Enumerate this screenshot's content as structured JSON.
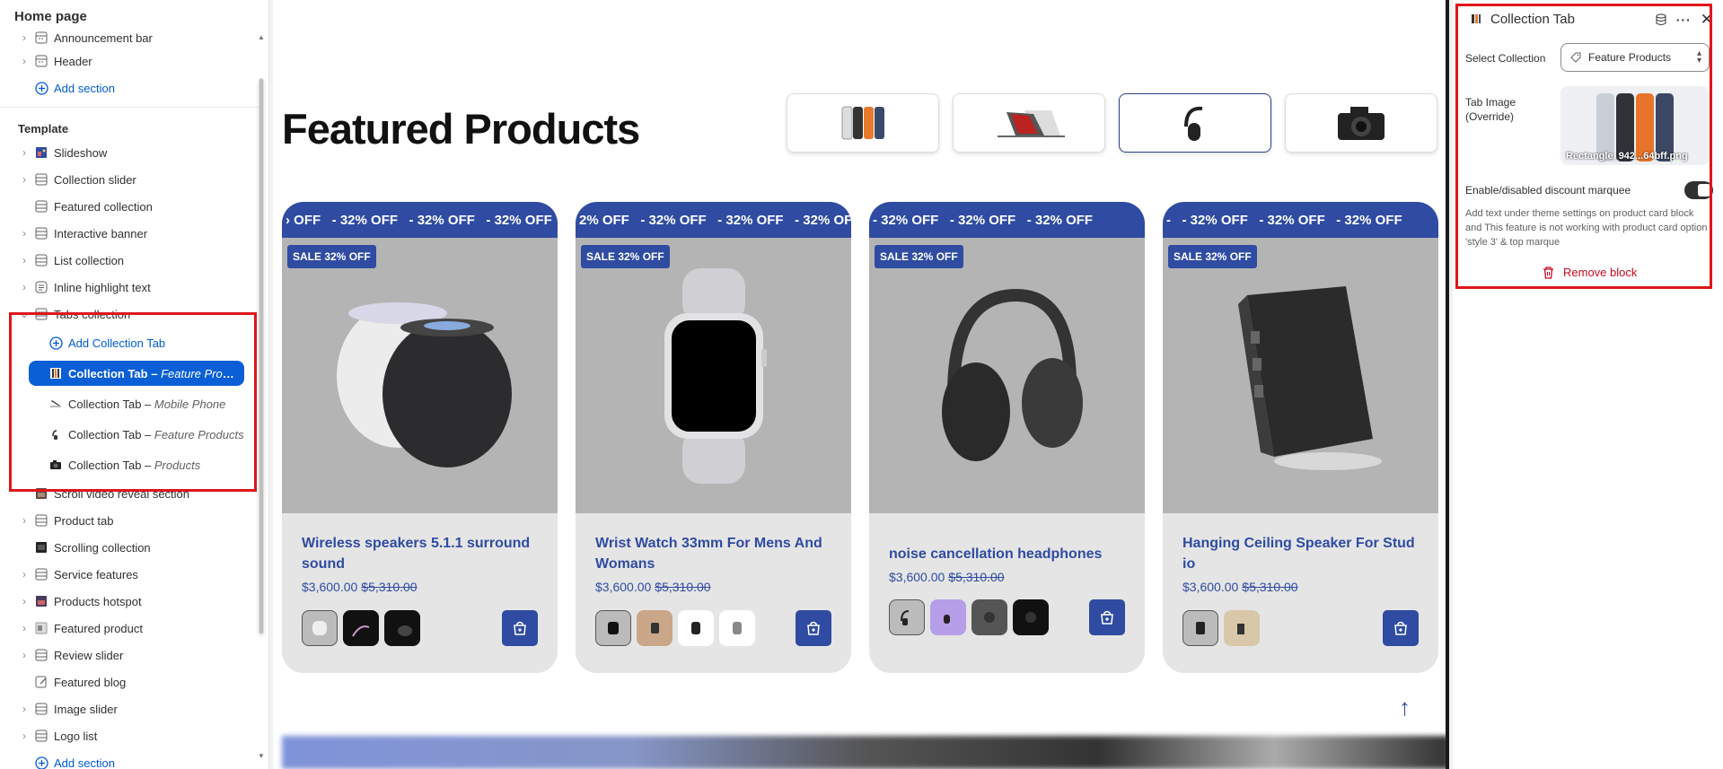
{
  "sidebar": {
    "title": "Home page",
    "header_items": [
      {
        "label": "Announcement bar"
      },
      {
        "label": "Header"
      }
    ],
    "add_section_label": "Add section",
    "template_heading": "Template",
    "template_items_before": [
      {
        "label": "Slideshow"
      },
      {
        "label": "Collection slider"
      },
      {
        "label": "Featured collection"
      },
      {
        "label": "Interactive banner"
      },
      {
        "label": "List collection"
      },
      {
        "label": "Inline highlight text"
      },
      {
        "label": "Tabs collection"
      }
    ],
    "tabs_children": {
      "add_label": "Add Collection Tab",
      "tabs": [
        {
          "label": "Collection Tab",
          "sep": " – ",
          "sub": "Feature Products"
        },
        {
          "label": "Collection Tab",
          "sep": " – ",
          "sub": "Mobile Phone"
        },
        {
          "label": "Collection Tab",
          "sep": " – ",
          "sub": "Feature Products"
        },
        {
          "label": "Collection Tab",
          "sep": " – ",
          "sub": "Products"
        }
      ]
    },
    "template_items_after": [
      {
        "label": "Scroll video reveal section"
      },
      {
        "label": "Product tab"
      },
      {
        "label": "Scrolling collection"
      },
      {
        "label": "Service features"
      },
      {
        "label": "Products hotspot"
      },
      {
        "label": "Featured product"
      },
      {
        "label": "Review slider"
      },
      {
        "label": "Featured blog"
      },
      {
        "label": "Image slider"
      },
      {
        "label": "Logo list"
      },
      {
        "label": "Add section"
      }
    ]
  },
  "preview": {
    "title": "Featured Products",
    "marquee_text": "- 32% OFF",
    "sale_badge": "SALE 32% OFF",
    "products": [
      {
        "name": "Wireless speakers 5.1.1 surround sound",
        "price": "$3,600.00",
        "compare_price": "$5,310.00",
        "marquee_lead": "› OFF"
      },
      {
        "name": "Wrist Watch 33mm For Mens And Womans",
        "price": "$3,600.00",
        "compare_price": "$5,310.00",
        "marquee_lead": "2% OFF"
      },
      {
        "name": "noise cancellation headphones",
        "price": "$3,600.00",
        "compare_price": "$5,310.00",
        "marquee_lead": ""
      },
      {
        "name": "Hanging Ceiling Speaker For Stud io",
        "price": "$3,600.00",
        "compare_price": "$5,310.00",
        "marquee_lead": "-"
      }
    ]
  },
  "panel": {
    "title": "Collection Tab",
    "select_label": "Select Collection",
    "select_value": "Feature Products",
    "image_label": "Tab Image (Override)",
    "image_filename": "Rectangle_942...64bff.png",
    "toggle_label": "Enable/disabled discount marquee",
    "help_text": "Add text under theme settings on product card block and This feature is not working with product card option 'style 3' & top marque",
    "remove_label": "Remove block"
  },
  "colors": {
    "accent": "#2f4ba2",
    "selection": "#0a5fd6",
    "highlight": "#e0161a",
    "danger": "#c70a24"
  }
}
